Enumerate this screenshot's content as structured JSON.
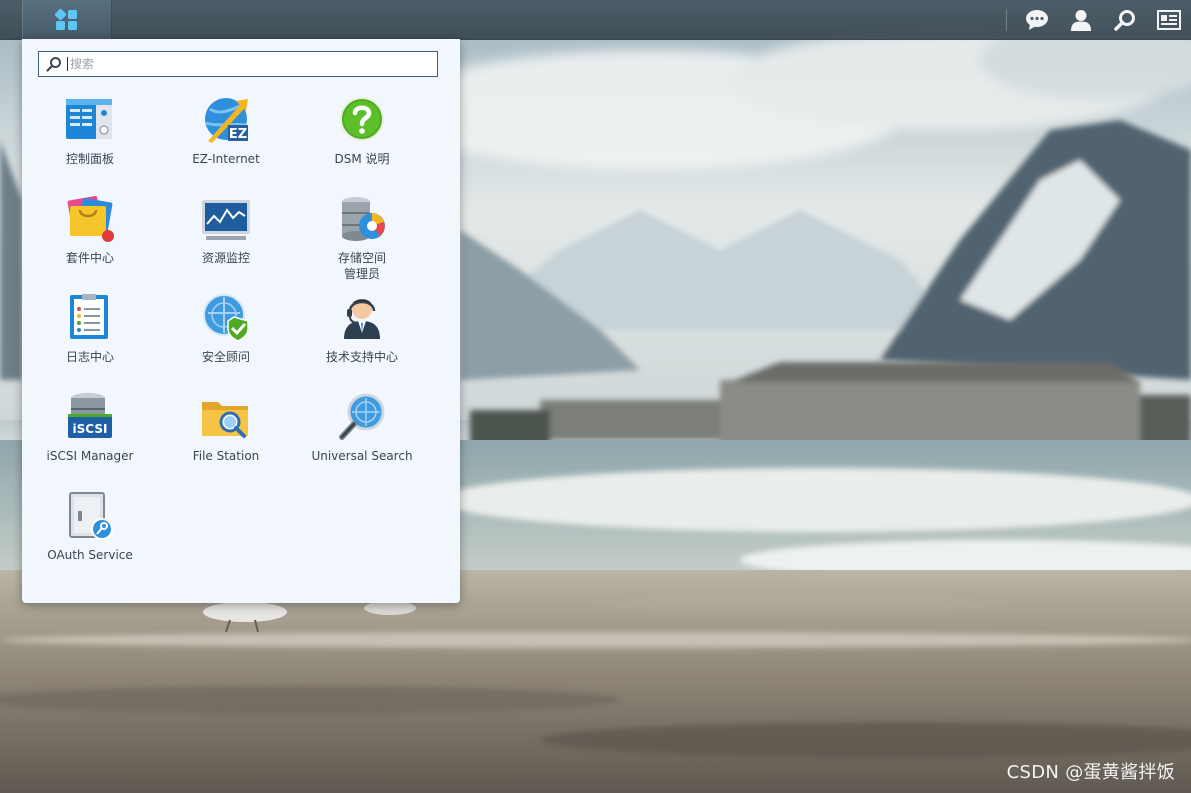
{
  "taskbar": {
    "main_menu_icon": "main-menu-grid-icon",
    "right_icons": [
      "chat-icon",
      "user-icon",
      "search-icon",
      "widgets-icon"
    ]
  },
  "menu": {
    "search_placeholder": "搜索",
    "apps": [
      {
        "label": "控制面板",
        "icon": "control-panel-icon"
      },
      {
        "label": "EZ-Internet",
        "icon": "ez-internet-icon"
      },
      {
        "label": "DSM 说明",
        "icon": "help-icon"
      },
      {
        "label": "套件中心",
        "icon": "package-center-icon"
      },
      {
        "label": "资源监控",
        "icon": "resource-monitor-icon"
      },
      {
        "label": "存储空间\n管理员",
        "icon": "storage-manager-icon"
      },
      {
        "label": "日志中心",
        "icon": "log-center-icon"
      },
      {
        "label": "安全顾问",
        "icon": "security-advisor-icon"
      },
      {
        "label": "技术支持中心",
        "icon": "support-center-icon"
      },
      {
        "label": "iSCSI Manager",
        "icon": "iscsi-manager-icon"
      },
      {
        "label": "File Station",
        "icon": "file-station-icon"
      },
      {
        "label": "Universal Search",
        "icon": "universal-search-icon"
      },
      {
        "label": "OAuth Service",
        "icon": "oauth-service-icon"
      }
    ]
  },
  "iscsi_badge": "iSCSI",
  "ez_badge": "EZ",
  "watermark": "CSDN @蛋黄酱拌饭"
}
